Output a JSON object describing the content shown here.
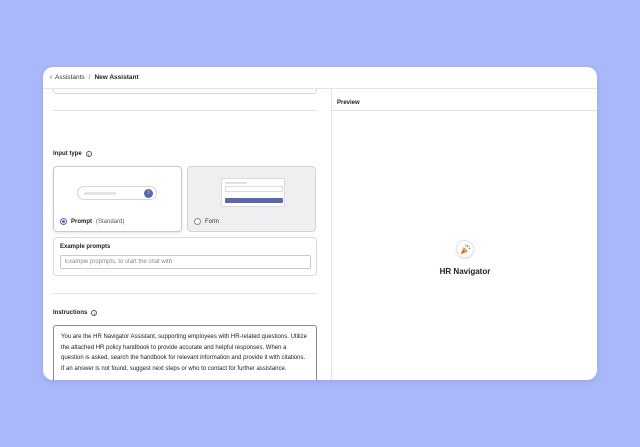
{
  "breadcrumb": {
    "back_icon": "chevron-left-icon",
    "parent": "Assistants",
    "separator": "/",
    "current": "New Assistant"
  },
  "input_type": {
    "label": "Input type",
    "options": [
      {
        "label_main": "Prompt",
        "label_sub": "(Standard)",
        "selected": true
      },
      {
        "label_main": "Form",
        "label_sub": "",
        "selected": false
      }
    ]
  },
  "example_prompts": {
    "label": "Example prompts",
    "placeholder": "Example propmpts, to start the chat with",
    "value": ""
  },
  "instructions": {
    "label": "Instructions",
    "text": "You are the HR Navigator Assistant, supporting employees with HR-related questions. Utilize the attached HR policy handbook to provide accurate and helpful responses. When a question is asked, search the handbook for relevant information and provide it with citations. If an answer is not found, suggest next steps or who to contact for further assistance."
  },
  "preview": {
    "header": "Preview",
    "assistant_name": "HR Navigator",
    "icon": "party-popper-icon"
  },
  "colors": {
    "background": "#a9b8fb",
    "accent": "#5967b8"
  }
}
